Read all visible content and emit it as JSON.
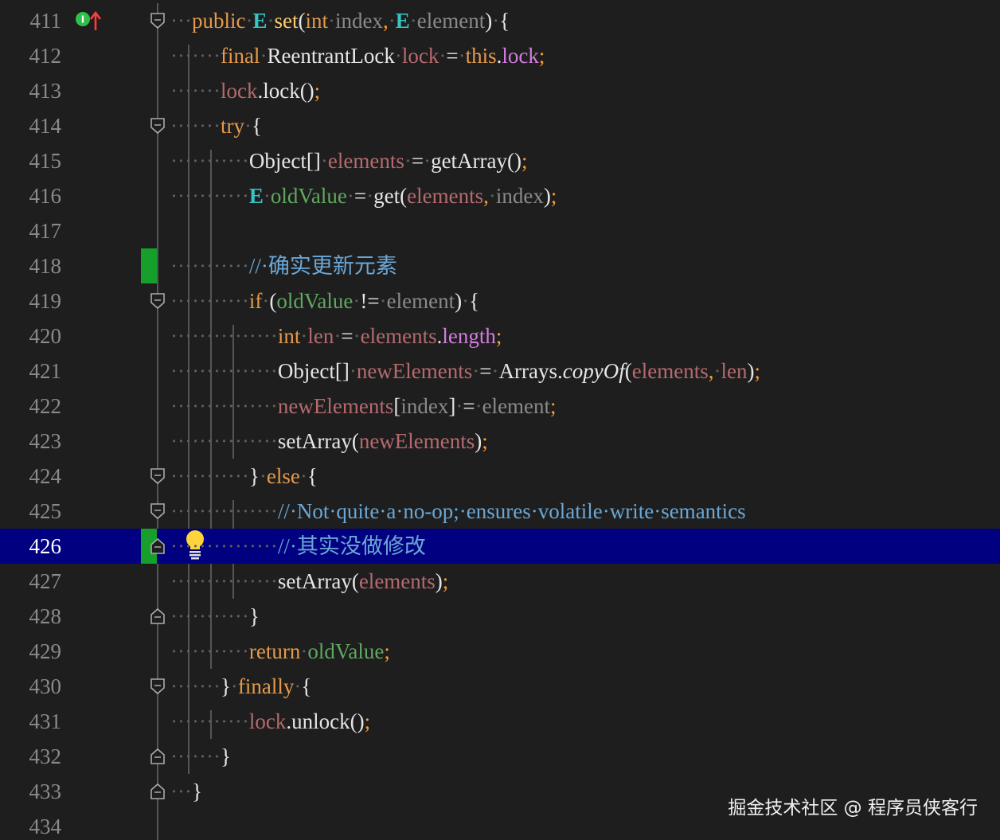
{
  "editor": {
    "current_line": 426,
    "lines": [
      {
        "number": "411",
        "tokens": [
          {
            "t": "···",
            "c": "dot"
          },
          {
            "t": "public",
            "c": "kw"
          },
          {
            "t": "·",
            "c": "dot"
          },
          {
            "t": "E",
            "c": "ty"
          },
          {
            "t": "·",
            "c": "dot"
          },
          {
            "t": "set",
            "c": "fn"
          },
          {
            "t": "(",
            "c": "wh"
          },
          {
            "t": "int",
            "c": "kw"
          },
          {
            "t": "·",
            "c": "dot"
          },
          {
            "t": "index",
            "c": "par"
          },
          {
            "t": ",",
            "c": "semi"
          },
          {
            "t": "·",
            "c": "dot"
          },
          {
            "t": "E",
            "c": "ty"
          },
          {
            "t": "·",
            "c": "dot"
          },
          {
            "t": "element",
            "c": "par"
          },
          {
            "t": ")",
            "c": "wh"
          },
          {
            "t": "·",
            "c": "dot"
          },
          {
            "t": "{",
            "c": "wh"
          }
        ]
      },
      {
        "number": "412",
        "tokens": [
          {
            "t": "·······",
            "c": "dot"
          },
          {
            "t": "final",
            "c": "kw"
          },
          {
            "t": "·",
            "c": "dot"
          },
          {
            "t": "ReentrantLock",
            "c": "wh"
          },
          {
            "t": "·",
            "c": "dot"
          },
          {
            "t": "lock",
            "c": "lv"
          },
          {
            "t": "·",
            "c": "dot"
          },
          {
            "t": "=",
            "c": "wh"
          },
          {
            "t": "·",
            "c": "dot"
          },
          {
            "t": "this",
            "c": "kw"
          },
          {
            "t": ".",
            "c": "wh"
          },
          {
            "t": "lock",
            "c": "fld"
          },
          {
            "t": ";",
            "c": "semi"
          }
        ]
      },
      {
        "number": "413",
        "tokens": [
          {
            "t": "·······",
            "c": "dot"
          },
          {
            "t": "lock",
            "c": "lv"
          },
          {
            "t": ".lock()",
            "c": "wh"
          },
          {
            "t": ";",
            "c": "semi"
          }
        ]
      },
      {
        "number": "414",
        "tokens": [
          {
            "t": "·······",
            "c": "dot"
          },
          {
            "t": "try",
            "c": "kw"
          },
          {
            "t": "·",
            "c": "dot"
          },
          {
            "t": "{",
            "c": "wh"
          }
        ]
      },
      {
        "number": "415",
        "tokens": [
          {
            "t": "···········",
            "c": "dot"
          },
          {
            "t": "Object[]",
            "c": "wh"
          },
          {
            "t": "·",
            "c": "dot"
          },
          {
            "t": "elements",
            "c": "lv"
          },
          {
            "t": "·",
            "c": "dot"
          },
          {
            "t": "=",
            "c": "wh"
          },
          {
            "t": "·",
            "c": "dot"
          },
          {
            "t": "getArray()",
            "c": "wh"
          },
          {
            "t": ";",
            "c": "semi"
          }
        ]
      },
      {
        "number": "416",
        "tokens": [
          {
            "t": "···········",
            "c": "dot"
          },
          {
            "t": "E",
            "c": "ty"
          },
          {
            "t": "·",
            "c": "dot"
          },
          {
            "t": "oldValue",
            "c": "grn"
          },
          {
            "t": "·",
            "c": "dot"
          },
          {
            "t": "=",
            "c": "wh"
          },
          {
            "t": "·",
            "c": "dot"
          },
          {
            "t": "get(",
            "c": "wh"
          },
          {
            "t": "elements",
            "c": "lv"
          },
          {
            "t": ",",
            "c": "semi"
          },
          {
            "t": "·",
            "c": "dot"
          },
          {
            "t": "index",
            "c": "par"
          },
          {
            "t": ")",
            "c": "wh"
          },
          {
            "t": ";",
            "c": "semi"
          }
        ]
      },
      {
        "number": "417",
        "tokens": []
      },
      {
        "number": "418",
        "tokens": [
          {
            "t": "···········",
            "c": "dot"
          },
          {
            "t": "//·确实更新元素",
            "c": "cm"
          }
        ]
      },
      {
        "number": "419",
        "tokens": [
          {
            "t": "···········",
            "c": "dot"
          },
          {
            "t": "if",
            "c": "kw"
          },
          {
            "t": "·",
            "c": "dot"
          },
          {
            "t": "(",
            "c": "wh"
          },
          {
            "t": "oldValue",
            "c": "grn"
          },
          {
            "t": "·",
            "c": "dot"
          },
          {
            "t": "!=",
            "c": "wh"
          },
          {
            "t": "·",
            "c": "dot"
          },
          {
            "t": "element",
            "c": "par"
          },
          {
            "t": ")",
            "c": "wh"
          },
          {
            "t": "·",
            "c": "dot"
          },
          {
            "t": "{",
            "c": "wh"
          }
        ]
      },
      {
        "number": "420",
        "tokens": [
          {
            "t": "···············",
            "c": "dot"
          },
          {
            "t": "int",
            "c": "kw"
          },
          {
            "t": "·",
            "c": "dot"
          },
          {
            "t": "len",
            "c": "lv"
          },
          {
            "t": "·",
            "c": "dot"
          },
          {
            "t": "=",
            "c": "wh"
          },
          {
            "t": "·",
            "c": "dot"
          },
          {
            "t": "elements",
            "c": "lv"
          },
          {
            "t": ".",
            "c": "wh"
          },
          {
            "t": "length",
            "c": "fld"
          },
          {
            "t": ";",
            "c": "semi"
          }
        ]
      },
      {
        "number": "421",
        "tokens": [
          {
            "t": "···············",
            "c": "dot"
          },
          {
            "t": "Object[]",
            "c": "wh"
          },
          {
            "t": "·",
            "c": "dot"
          },
          {
            "t": "newElements",
            "c": "lv"
          },
          {
            "t": "·",
            "c": "dot"
          },
          {
            "t": "=",
            "c": "wh"
          },
          {
            "t": "·",
            "c": "dot"
          },
          {
            "t": "Arrays.",
            "c": "wh"
          },
          {
            "t": "copyOf",
            "c": "wh it"
          },
          {
            "t": "(",
            "c": "wh"
          },
          {
            "t": "elements",
            "c": "lv"
          },
          {
            "t": ",",
            "c": "semi"
          },
          {
            "t": "·",
            "c": "dot"
          },
          {
            "t": "len",
            "c": "lv"
          },
          {
            "t": ")",
            "c": "wh"
          },
          {
            "t": ";",
            "c": "semi"
          }
        ]
      },
      {
        "number": "422",
        "tokens": [
          {
            "t": "···············",
            "c": "dot"
          },
          {
            "t": "newElements",
            "c": "lv"
          },
          {
            "t": "[",
            "c": "wh"
          },
          {
            "t": "index",
            "c": "par"
          },
          {
            "t": "]",
            "c": "wh"
          },
          {
            "t": "·",
            "c": "dot"
          },
          {
            "t": "=",
            "c": "wh"
          },
          {
            "t": "·",
            "c": "dot"
          },
          {
            "t": "element",
            "c": "par"
          },
          {
            "t": ";",
            "c": "semi"
          }
        ]
      },
      {
        "number": "423",
        "tokens": [
          {
            "t": "···············",
            "c": "dot"
          },
          {
            "t": "setArray(",
            "c": "wh"
          },
          {
            "t": "newElements",
            "c": "lv"
          },
          {
            "t": ")",
            "c": "wh"
          },
          {
            "t": ";",
            "c": "semi"
          }
        ]
      },
      {
        "number": "424",
        "tokens": [
          {
            "t": "···········",
            "c": "dot"
          },
          {
            "t": "}",
            "c": "wh"
          },
          {
            "t": "·",
            "c": "dot"
          },
          {
            "t": "else",
            "c": "kw"
          },
          {
            "t": "·",
            "c": "dot"
          },
          {
            "t": "{",
            "c": "wh"
          }
        ]
      },
      {
        "number": "425",
        "tokens": [
          {
            "t": "···············",
            "c": "dot"
          },
          {
            "t": "//·Not·quite·a·no-op;·ensures·volatile·write·semantics",
            "c": "cm"
          }
        ]
      },
      {
        "number": "426",
        "tokens": [
          {
            "t": "···············",
            "c": "dot"
          },
          {
            "t": "//·其实没做修改",
            "c": "cm"
          }
        ]
      },
      {
        "number": "427",
        "tokens": [
          {
            "t": "···············",
            "c": "dot"
          },
          {
            "t": "setArray(",
            "c": "wh"
          },
          {
            "t": "elements",
            "c": "lv"
          },
          {
            "t": ")",
            "c": "wh"
          },
          {
            "t": ";",
            "c": "semi"
          }
        ]
      },
      {
        "number": "428",
        "tokens": [
          {
            "t": "···········",
            "c": "dot"
          },
          {
            "t": "}",
            "c": "wh"
          }
        ]
      },
      {
        "number": "429",
        "tokens": [
          {
            "t": "···········",
            "c": "dot"
          },
          {
            "t": "return",
            "c": "kw"
          },
          {
            "t": "·",
            "c": "dot"
          },
          {
            "t": "oldValue",
            "c": "grn"
          },
          {
            "t": ";",
            "c": "semi"
          }
        ]
      },
      {
        "number": "430",
        "tokens": [
          {
            "t": "·······",
            "c": "dot"
          },
          {
            "t": "}",
            "c": "wh"
          },
          {
            "t": "·",
            "c": "dot"
          },
          {
            "t": "finally",
            "c": "kw"
          },
          {
            "t": "·",
            "c": "dot"
          },
          {
            "t": "{",
            "c": "wh"
          }
        ]
      },
      {
        "number": "431",
        "tokens": [
          {
            "t": "···········",
            "c": "dot"
          },
          {
            "t": "lock",
            "c": "lv"
          },
          {
            "t": ".unlock()",
            "c": "wh"
          },
          {
            "t": ";",
            "c": "semi"
          }
        ]
      },
      {
        "number": "432",
        "tokens": [
          {
            "t": "·······",
            "c": "dot"
          },
          {
            "t": "}",
            "c": "wh"
          }
        ]
      },
      {
        "number": "433",
        "tokens": [
          {
            "t": "···",
            "c": "dot"
          },
          {
            "t": "}",
            "c": "wh"
          }
        ]
      },
      {
        "number": "434",
        "tokens": []
      }
    ],
    "fold_open_lines": [
      "411",
      "414",
      "419",
      "424",
      "425",
      "430"
    ],
    "fold_close_lines": [
      "426",
      "428",
      "432",
      "433"
    ],
    "change_marker_lines": [
      "418",
      "426"
    ],
    "bulb_line": "426",
    "implementation_icon_line": "411",
    "colors": {
      "background": "#1e1e1e",
      "current_line": "#000080",
      "keyword": "#e49a4a",
      "type_param": "#36c4c4",
      "method_decl": "#ffcb6b",
      "parameter": "#8a8a8a",
      "local_var": "#b56a6e",
      "field": "#d27ddf",
      "comment": "#6aa7d6",
      "change_marker": "#16a02b"
    }
  },
  "watermark": {
    "text": "掘金技术社区 @ 程序员侠客行"
  }
}
